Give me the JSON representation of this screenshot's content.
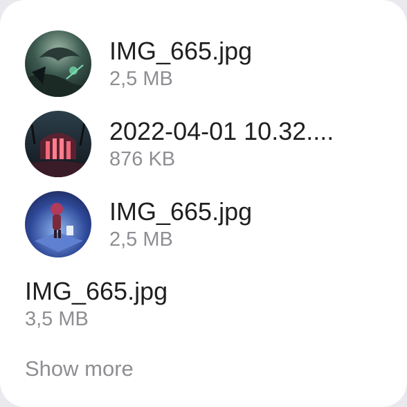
{
  "files": [
    {
      "name": "IMG_665.jpg",
      "size": "2,5 MB",
      "thumbnail": "dark-green-fantasy-art"
    },
    {
      "name": "2022-04-01 10.32....",
      "size": "876 KB",
      "thumbnail": "pink-temple-fantasy-art"
    },
    {
      "name": "IMG_665.jpg",
      "size": "2,5 MB",
      "thumbnail": "blue-character-fantasy-art"
    },
    {
      "name": "IMG_665.jpg",
      "size": "3,5 MB",
      "thumbnail": ""
    }
  ],
  "show_more_label": "Show more",
  "colors": {
    "card_background": "#ffffff",
    "primary_text": "#1f1f1f",
    "secondary_text": "#8e8e93"
  }
}
